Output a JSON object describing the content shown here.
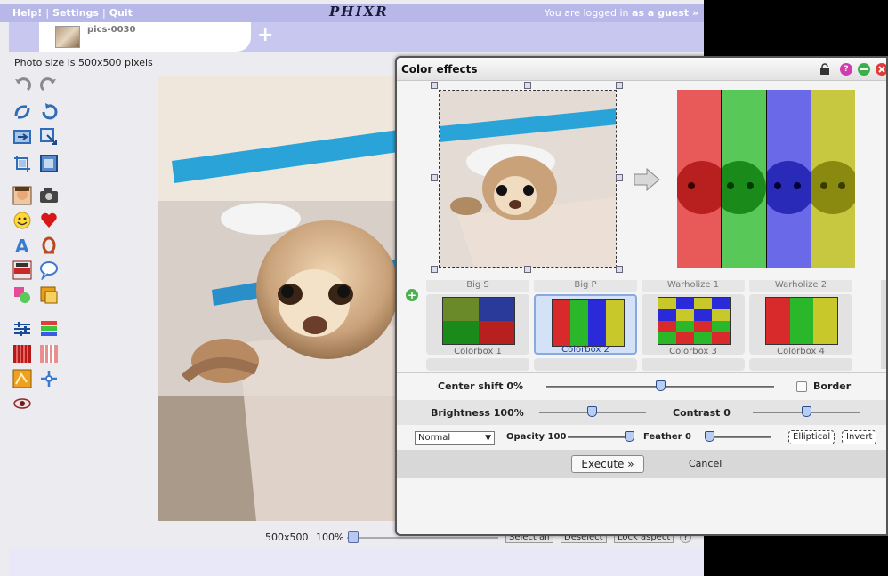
{
  "menu": {
    "help": "Help!",
    "settings": "Settings",
    "quit": "Quit"
  },
  "logo": "PHIXR",
  "login": {
    "prefix": "You are logged in",
    "user": "as a guest »"
  },
  "tab": {
    "name": "pics-0030",
    "add": "+"
  },
  "photo_size": "Photo size is 500x500 pixels",
  "footer": {
    "size": "500x500",
    "zoom": "100%",
    "select_all": "Select all",
    "deselect": "Deselect",
    "lock_aspect": "Lock aspect",
    "help": "?"
  },
  "dialog": {
    "title": "Color effects",
    "lock": "lock-icon",
    "help": "?",
    "top_labels": [
      "Big S",
      "Big P",
      "Warholize 1",
      "Warholize 2"
    ],
    "effects": [
      "Colorbox 1",
      "Colorbox 2",
      "Colorbox 3",
      "Colorbox 4"
    ],
    "selected_effect": "Colorbox 2",
    "center_shift": "Center shift 0%",
    "border": "Border",
    "brightness": "Brightness 100%",
    "contrast": "Contrast 0",
    "blend_mode": "Normal",
    "opacity": "Opacity 100",
    "feather": "Feather 0",
    "elliptical": "Elliptical",
    "invert": "Invert",
    "execute": "Execute »",
    "cancel": "Cancel",
    "levels": {
      "center_shift_pct": 0,
      "brightness_pct": 100,
      "contrast": 0,
      "opacity": 100,
      "feather": 0,
      "zoom_pct": 100
    }
  },
  "colors": {
    "topbar": "#b8b8e8",
    "tabbar": "#c7c7f0",
    "accent": "#8aa8e0"
  }
}
